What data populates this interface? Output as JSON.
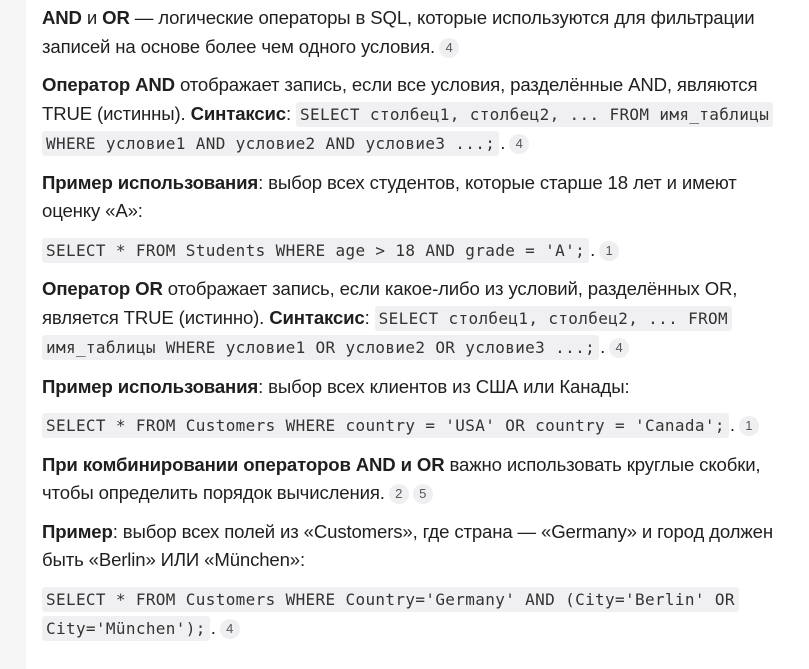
{
  "p1": {
    "b1": "AND",
    "t1": " и ",
    "b2": "OR",
    "t2": " — логические операторы в SQL, которые используются для фильтрации записей на основе более чем одного условия.",
    "ref": "4"
  },
  "p2": {
    "b1": "Оператор AND",
    "t1": " отображает запись, если все условия, разделённые AND, являются TRUE (истинны). ",
    "b2": "Синтаксис",
    "t2": ": ",
    "code": "SELECT столбец1, столбец2, ... FROM имя_таблицы WHERE условие1 AND условие2 AND условие3 ...;",
    "dot": ".",
    "ref": "4"
  },
  "p3": {
    "b1": "Пример использования",
    "t1": ": выбор всех студентов, которые старше 18 лет и имеют оценку «A»:"
  },
  "code1": {
    "code": "SELECT * FROM Students WHERE age > 18 AND grade = 'A';",
    "dot": ".",
    "ref": "1"
  },
  "p4": {
    "b1": "Оператор OR",
    "t1": " отображает запись, если какое-либо из условий, разделённых OR, является TRUE (истинно). ",
    "b2": "Синтаксис",
    "t2": ": ",
    "code": "SELECT столбец1, столбец2, ... FROM имя_таблицы WHERE условие1 OR условие2 OR условие3 ...;",
    "dot": ".",
    "ref": "4"
  },
  "p5": {
    "b1": "Пример использования",
    "t1": ": выбор всех клиентов из США или Канады:"
  },
  "code2": {
    "code": "SELECT * FROM Customers WHERE country = 'USA' OR country = 'Canada';",
    "dot": ".",
    "ref": "1"
  },
  "p6": {
    "b1": "При комбинировании операторов AND и OR",
    "t1": " важно использовать круглые скобки, чтобы определить порядок вычисления.",
    "ref1": "2",
    "ref2": "5"
  },
  "p7": {
    "b1": "Пример",
    "t1": ": выбор всех полей из «Customers», где страна — «Germany» и город должен быть «Berlin» ИЛИ «München»:"
  },
  "code3": {
    "code": "SELECT * FROM Customers WHERE Country='Germany' AND (City='Berlin' OR City='München');",
    "dot": ".",
    "ref": "4"
  }
}
